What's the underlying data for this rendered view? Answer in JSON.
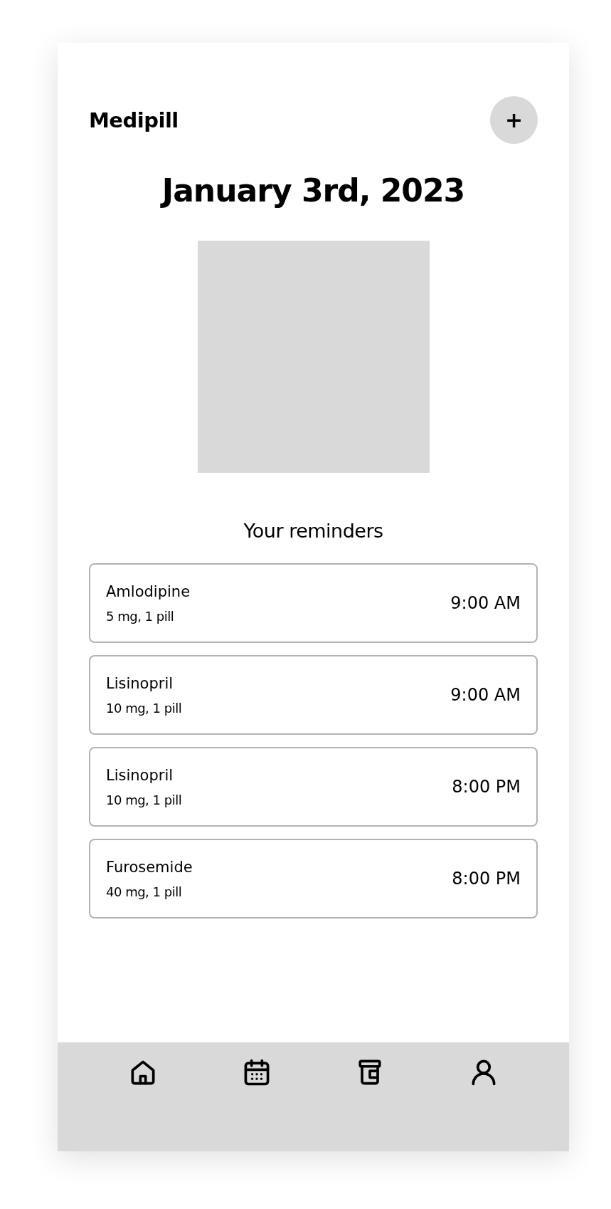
{
  "header": {
    "title": "Medipill",
    "add_button": "+"
  },
  "date": "January 3rd, 2023",
  "reminders_title": "Your reminders",
  "reminders": [
    {
      "name": "Amlodipine",
      "dose": "5 mg, 1 pill",
      "time": "9:00 AM"
    },
    {
      "name": "Lisinopril",
      "dose": "10 mg, 1 pill",
      "time": "9:00 AM"
    },
    {
      "name": "Lisinopril",
      "dose": "10 mg, 1 pill",
      "time": "8:00 PM"
    },
    {
      "name": "Furosemide",
      "dose": "40 mg, 1 pill",
      "time": "8:00 PM"
    }
  ],
  "nav": [
    {
      "kind": "home"
    },
    {
      "kind": "calendar"
    },
    {
      "kind": "medicine"
    },
    {
      "kind": "profile"
    }
  ]
}
